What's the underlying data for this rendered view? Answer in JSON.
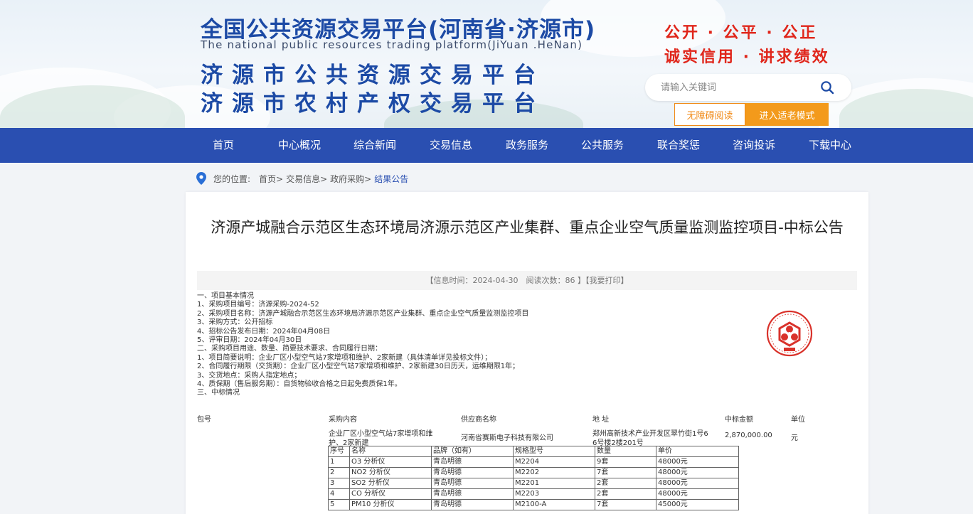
{
  "header": {
    "title_cn": "全国公共资源交易平台(河南省·济源市)",
    "title_en": "The national public resources trading platform(JiYuan .HeNan)",
    "subtitle1": "济源市公共资源交易平台",
    "subtitle2": "济源市农村产权交易平台",
    "slogan1": "公开 · 公平 · 公正",
    "slogan2": "诚实信用 · 讲求绩效",
    "search_placeholder": "请输入关键词",
    "accessibility_label": "无障碍阅读",
    "elder_mode_label": "进入适老模式"
  },
  "nav": [
    "首页",
    "中心概况",
    "综合新闻",
    "交易信息",
    "政务服务",
    "公共服务",
    "联合奖惩",
    "咨询投诉",
    "下载中心"
  ],
  "breadcrumb": {
    "prefix": "您的位置:",
    "items": [
      "首页>",
      "交易信息>",
      "政府采购>"
    ],
    "current": "结果公告"
  },
  "article": {
    "title": "济源产城融合示范区生态环境局济源示范区产业集群、重点企业空气质量监测监控项目-中标公告",
    "meta": "【信息时间：2024-04-30　阅读次数：86 】【我要打印】",
    "lines": [
      "一、项目基本情况",
      "1、采购项目编号：济源采购-2024-52",
      "2、采购项目名称：济源产城融合示范区生态环境局济源示范区产业集群、重点企业空气质量监测监控项目",
      "3、采购方式：公开招标",
      "4、招标公告发布日期：2024年04月08日",
      "5、评审日期：2024年04月30日",
      "二、采购项目用途、数量、简要技术要求、合同履行日期：",
      "1、项目简要说明：企业厂区小型空气站7家增项和维护、2家新建（具体清单详见投标文件）；",
      "2、合同履行期限（交货期）：企业厂区小型空气站7家增项和维护、2家新建30日历天，运维期限1年；",
      "3、交货地点：采购人指定地点；",
      "4、质保期（售后服务期）：自货物验收合格之日起免费质保1年。",
      "三、中标情况"
    ],
    "result_headers": [
      "包号",
      "采购内容",
      "供应商名称",
      "地 址",
      "中标金额",
      "单位"
    ],
    "result_row": {
      "content_l1": "企业厂区小型空气站7家增项和维",
      "content_l2": "护、2家新建",
      "supplier": "河南省赛斯电子科技有限公司",
      "address_l1": "郑州高新技术产业开发区翠竹街1号6",
      "address_l2": "6号楼2楼201号",
      "amount": "2,870,000.00",
      "unit": "元"
    },
    "spec_table": {
      "headers": [
        "序号",
        "名称",
        "品牌（如有）",
        "规格型号",
        "数量",
        "单价"
      ],
      "rows": [
        [
          "1",
          "O3 分析仪",
          "青岛明德",
          "M2204",
          "9套",
          "48000元"
        ],
        [
          "2",
          "NO2 分析仪",
          "青岛明德",
          "M2202",
          "7套",
          "48000元"
        ],
        [
          "3",
          "SO2 分析仪",
          "青岛明德",
          "M2201",
          "2套",
          "48000元"
        ],
        [
          "4",
          "CO 分析仪",
          "青岛明德",
          "M2203",
          "2套",
          "48000元"
        ],
        [
          "5",
          "PM10 分析仪",
          "青岛明德",
          "M2100-A",
          "7套",
          "45000元"
        ]
      ]
    }
  },
  "colors": {
    "brand_blue": "#2a4fb1",
    "title_blue": "#1c4aa5",
    "slogan_red": "#e0261b",
    "accent_orange": "#f39a1b",
    "seal_red": "#d9322b"
  }
}
